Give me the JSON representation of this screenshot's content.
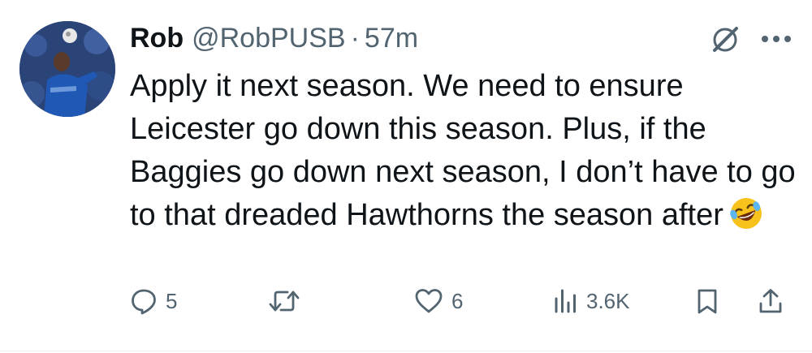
{
  "tweet": {
    "author_name": "Rob",
    "handle": "@RobPUSB",
    "separator": "·",
    "time": "57m",
    "text": "Apply it next season. We need to ensure Leicester go down this season. Plus, if the Baggies go down next season, I don’t have to go to that dreaded Hawthorns the season after",
    "emoji": "rolling-on-the-floor-laughing"
  },
  "actions": {
    "replies": "5",
    "retweets": "",
    "likes": "6",
    "views": "3.6K"
  },
  "icons": {
    "grok": "grok-icon",
    "more": "more-icon",
    "reply": "reply-icon",
    "retweet": "retweet-icon",
    "like": "heart-icon",
    "views": "views-icon",
    "bookmark": "bookmark-icon",
    "share": "share-icon"
  },
  "colors": {
    "text": "#0f1419",
    "secondary": "#536471",
    "divider": "#eff3f4",
    "emoji": "#f7c21b"
  }
}
